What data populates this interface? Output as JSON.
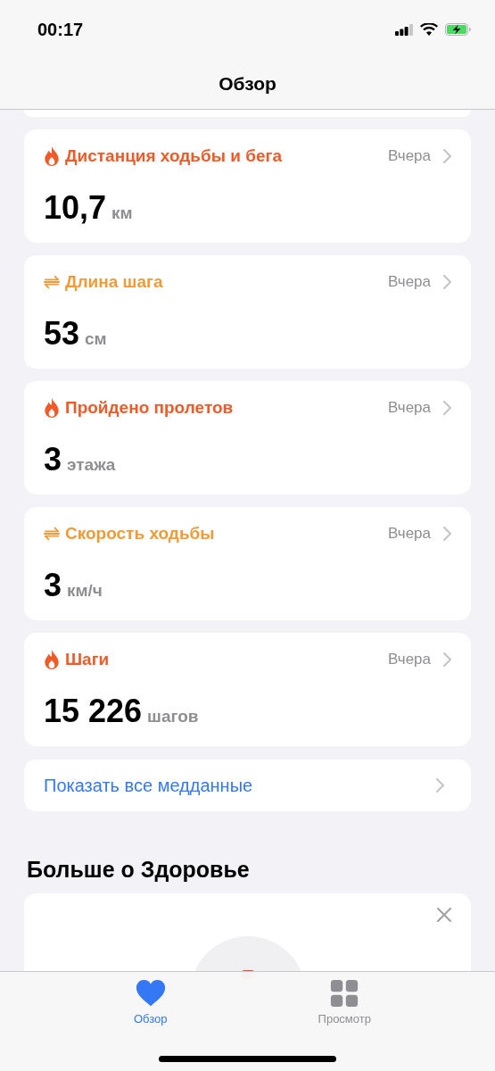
{
  "status_bar": {
    "time": "00:17"
  },
  "nav_bar": {
    "title": "Обзор"
  },
  "cards": [
    {
      "kind": "flame",
      "color": "#f05a28",
      "title": "Дистанция ходьбы и бега",
      "date": "Вчера",
      "value": "10,7",
      "unit": "км"
    },
    {
      "kind": "arrows",
      "color": "#f19a38",
      "title": "Длина шага",
      "date": "Вчера",
      "value": "53",
      "unit": "см"
    },
    {
      "kind": "flame",
      "color": "#f05a28",
      "title": "Пройдено пролетов",
      "date": "Вчера",
      "value": "3",
      "unit": "этажа"
    },
    {
      "kind": "arrows",
      "color": "#f19a38",
      "title": "Скорость ходьбы",
      "date": "Вчера",
      "value": "3",
      "unit": "км/ч"
    },
    {
      "kind": "flame",
      "color": "#f05a28",
      "title": "Шаги",
      "date": "Вчера",
      "value": "15 226",
      "unit": "шагов"
    }
  ],
  "show_all": {
    "label": "Показать все медданные"
  },
  "section": {
    "title": "Больше о Здоровье"
  },
  "tab_bar": [
    {
      "label": "Обзор",
      "selected": true
    },
    {
      "label": "Просмотр",
      "selected": false
    }
  ]
}
